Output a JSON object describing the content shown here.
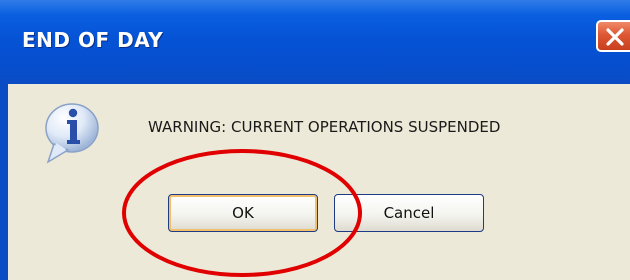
{
  "dialog": {
    "title": "END OF DAY",
    "message": "WARNING: CURRENT OPERATIONS SUSPENDED",
    "icon": "info-icon",
    "buttons": {
      "ok_label": "OK",
      "cancel_label": "Cancel"
    }
  },
  "colors": {
    "titlebar": "#0653d6",
    "body": "#ece9d8",
    "close_button": "#de5834",
    "annotation": "#e00000",
    "default_button_highlight": "#f2c06a"
  }
}
